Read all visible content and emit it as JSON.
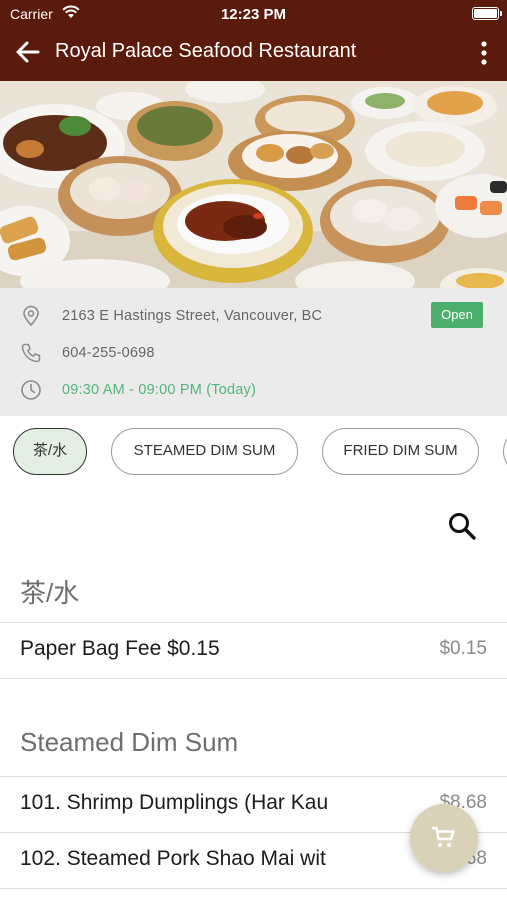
{
  "status_bar": {
    "carrier": "Carrier",
    "time": "12:23 PM"
  },
  "header": {
    "title": "Royal Palace Seafood Restaurant"
  },
  "info": {
    "address": "2163 E Hastings Street, Vancouver, BC",
    "phone": "604-255-0698",
    "hours": "09:30 AM - 09:00 PM (Today)",
    "status": "Open"
  },
  "tabs": [
    {
      "label": "茶/水"
    },
    {
      "label": "STEAMED DIM SUM"
    },
    {
      "label": "FRIED DIM SUM"
    }
  ],
  "sections": [
    {
      "title": "茶/水",
      "items": [
        {
          "name": "Paper Bag Fee $0.15",
          "price": "$0.15"
        }
      ]
    },
    {
      "title": "Steamed Dim Sum",
      "items": [
        {
          "name": "101. Shrimp Dumplings (Har Kau",
          "price": "$8.68"
        },
        {
          "name": "102. Steamed Pork Shao Mai wit",
          "price": "$8.68"
        }
      ]
    }
  ],
  "colors": {
    "header": "#5a1a0c",
    "open_badge": "#4caf6d",
    "hours_text": "#52b57a",
    "fab": "#d9d2b8"
  }
}
